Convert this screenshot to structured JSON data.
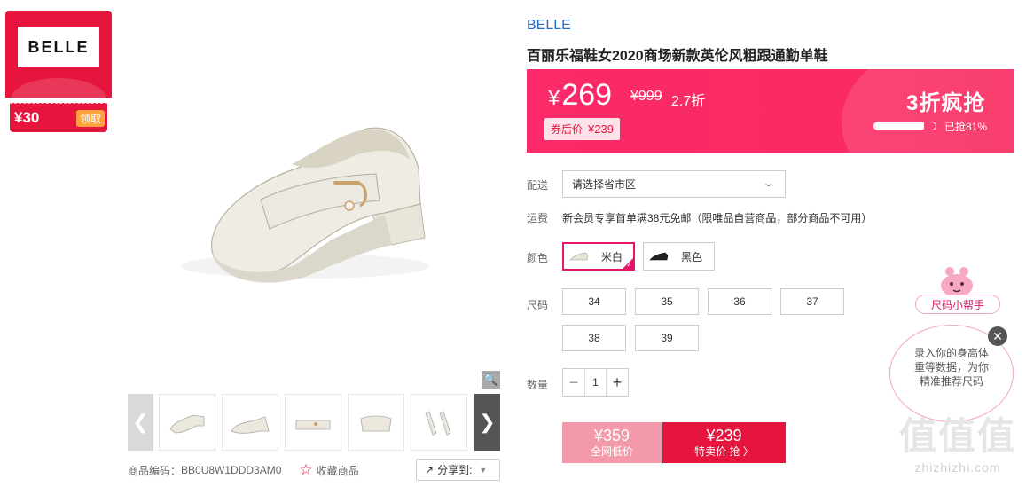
{
  "coupon": {
    "logo_text": "BELLE",
    "amount": "¥30",
    "action": "领取"
  },
  "gallery": {
    "thumbnail_count": 5,
    "product_code_label": "商品编码：",
    "product_code": "BB0U8W1DDD3AM0",
    "favorite_label": "收藏商品",
    "share_label": "分享到:"
  },
  "product": {
    "brand": "BELLE",
    "title": "百丽乐福鞋女2020商场新款英伦风粗跟通勤单鞋"
  },
  "price": {
    "current": "269",
    "currency": "¥",
    "original": "¥999",
    "discount": "2.7折",
    "after_coupon_label": "券后价",
    "after_coupon_value": "¥239",
    "flash_title": "3折疯抢",
    "flash_progress": 0.81,
    "flash_label": "已抢81%"
  },
  "delivery": {
    "label": "配送",
    "select_placeholder": "请选择省市区"
  },
  "shipping": {
    "label": "运费",
    "text": "新会员专享首单满38元免邮（限唯品自营商品，部分商品不可用）"
  },
  "colors": {
    "label": "颜色",
    "options": [
      {
        "name": "米白",
        "selected": true,
        "swatch": "#ece7dc"
      },
      {
        "name": "黑色",
        "selected": false,
        "swatch": "#222222"
      }
    ]
  },
  "sizes": {
    "label": "尺码",
    "options": [
      "34",
      "35",
      "36",
      "37",
      "38",
      "39"
    ]
  },
  "quantity": {
    "label": "数量",
    "value": "1",
    "minus": "−",
    "plus": "+"
  },
  "buttons": {
    "low_price": "¥359",
    "low_label": "全网低价",
    "buy_price": "¥239",
    "buy_label": "特卖价 抢 〉"
  },
  "helper": {
    "tag": "尺码小帮手",
    "bubble_line1": "录入你的身高体",
    "bubble_line2": "重等数据，为你",
    "bubble_line3": "精准推荐尺码"
  },
  "watermark": {
    "big": "值值值",
    "small": "zhizhizhi.com"
  },
  "colors_theme": {
    "accent": "#e5153d",
    "price_bar": "#fb2a68",
    "link": "#2b6cc4"
  }
}
